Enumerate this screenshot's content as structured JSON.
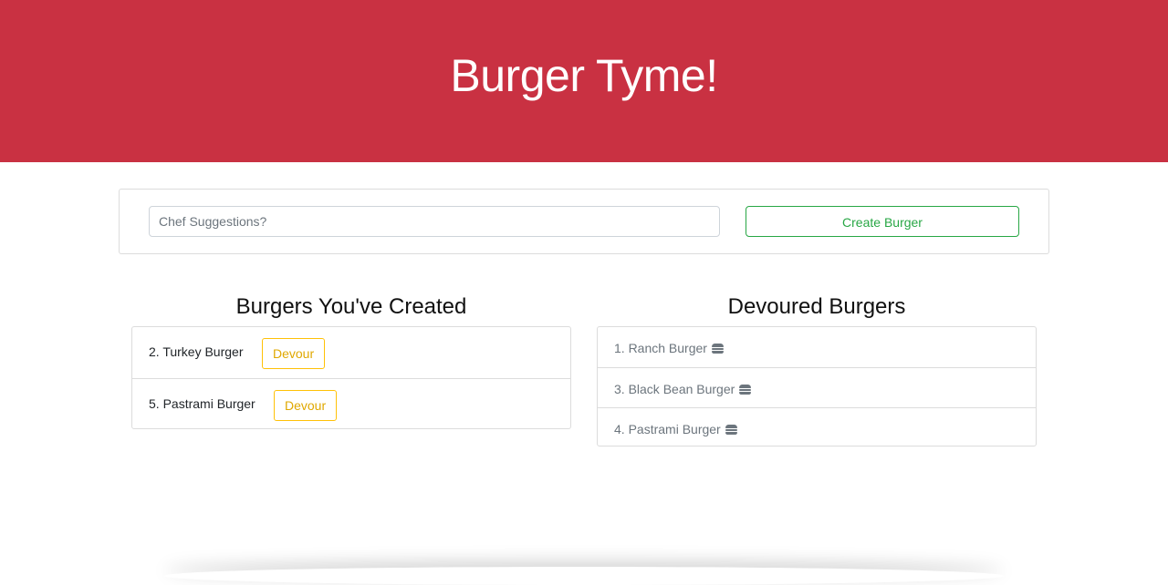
{
  "header": {
    "title": "Burger Tyme!"
  },
  "form": {
    "placeholder": "Chef Suggestions?",
    "value": "",
    "create_label": "Create Burger"
  },
  "created": {
    "heading": "Burgers You've Created",
    "items": [
      {
        "label": "2. Turkey Burger",
        "button": "Devour"
      },
      {
        "label": "5. Pastrami Burger",
        "button": "Devour"
      }
    ]
  },
  "devoured": {
    "heading": "Devoured Burgers",
    "icon": "hamburger-icon",
    "items": [
      {
        "label": "1. Ranch Burger"
      },
      {
        "label": "3. Black Bean Burger"
      },
      {
        "label": "4. Pastrami Burger"
      }
    ]
  },
  "colors": {
    "hero": "#c93142",
    "create": "#28a745",
    "devour": "#ffc107",
    "muted": "#6c757d"
  }
}
